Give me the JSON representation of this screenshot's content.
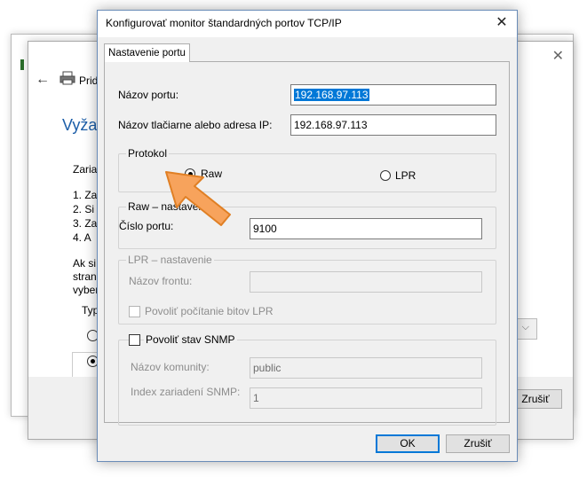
{
  "background": {
    "window_title": "Prid",
    "heading": "Vyžad",
    "intro": "Zaria",
    "steps": [
      "1. Za",
      "2. Si",
      "3. Za",
      "4. A"
    ],
    "paragraph": [
      "Ak si",
      "stran",
      "vyber"
    ],
    "group_label": "Typ",
    "cancel_label": "Zrušiť"
  },
  "dialog": {
    "title": "Konfigurovať monitor štandardných portov TCP/IP",
    "tab_label": "Nastavenie portu",
    "port_name_label": "Názov portu:",
    "port_name_value": "192.168.97.113",
    "printer_addr_label": "Názov tlačiarne alebo adresa IP:",
    "printer_addr_value": "192.168.97.113",
    "protocol": {
      "legend": "Protokol",
      "raw_label": "Raw",
      "lpr_label": "LPR",
      "selected": "Raw"
    },
    "raw_settings": {
      "legend": "Raw – nastavenie",
      "port_number_label": "Číslo portu:",
      "port_number_value": "9100"
    },
    "lpr_settings": {
      "legend": "LPR – nastavenie",
      "queue_name_label": "Názov frontu:",
      "queue_name_value": "",
      "byte_count_label": "Povoliť počítanie bitov LPR"
    },
    "snmp": {
      "legend": "Povoliť stav SNMP",
      "community_label": "Názov komunity:",
      "community_value": "public",
      "device_index_label": "Index zariadení SNMP:",
      "device_index_value": "1"
    },
    "ok_label": "OK",
    "cancel_label": "Zrušiť"
  },
  "colors": {
    "accent": "#0078d7",
    "heading_blue": "#1c5ea8",
    "pointer_orange": "#f7a35c"
  }
}
